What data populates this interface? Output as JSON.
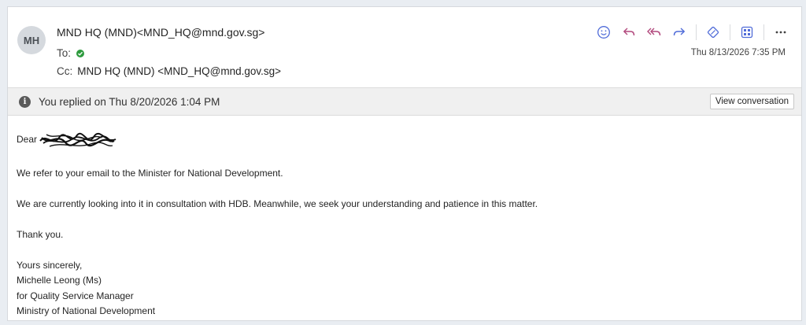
{
  "header": {
    "avatar_initials": "MH",
    "from": "MND HQ (MND)<MND_HQ@mnd.gov.sg>",
    "to_label": "To:",
    "cc_label": "Cc:",
    "cc_value": "MND HQ (MND) <MND_HQ@mnd.gov.sg>",
    "date": "Thu 8/13/2026 7:35 PM"
  },
  "toolbar": {
    "icons": [
      "emoji-icon",
      "reply-icon",
      "reply-all-icon",
      "forward-icon",
      "tag-icon",
      "apps-icon",
      "more-icon"
    ],
    "accent_color": "#4f6bd8"
  },
  "banner": {
    "text": "You replied on Thu 8/20/2026 1:04 PM",
    "button_label": "View conversation"
  },
  "body": {
    "greeting": "Dear",
    "line1": "We refer to your email to the Minister for National Development.",
    "line2": "We are currently looking into it in consultation with HDB. Meanwhile, we seek your understanding and patience in this matter.",
    "line3": "Thank you.",
    "sign1": "Yours sincerely,",
    "sign2": "Michelle Leong (Ms)",
    "sign3": "for Quality Service Manager",
    "sign4": "Ministry of National Development"
  }
}
